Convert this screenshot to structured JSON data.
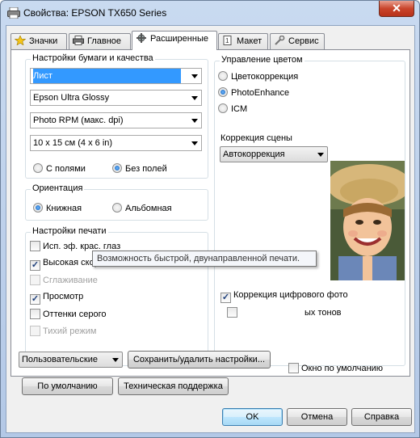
{
  "window": {
    "title": "Свойства: EPSON TX650 Series",
    "close_glyph": "✕"
  },
  "tabs": [
    {
      "label": "Значки",
      "icon": "star-icon"
    },
    {
      "label": "Главное",
      "icon": "printer-icon"
    },
    {
      "label": "Расширенные",
      "icon": "gear-icon",
      "active": true
    },
    {
      "label": "Макет",
      "icon": "page-layout-icon"
    },
    {
      "label": "Сервис",
      "icon": "wrench-icon"
    }
  ],
  "paper": {
    "group_label": "Настройки бумаги и качества",
    "source": "Лист",
    "type": "Epson Ultra Glossy",
    "quality": "Photo RPM (макс. dpi)",
    "size": "10 x 15 см (4 x 6 in)",
    "border_with": "С полями",
    "border_without": "Без полей"
  },
  "orientation": {
    "group_label": "Ориентация",
    "portrait": "Книжная",
    "landscape": "Альбомная"
  },
  "print_settings": {
    "group_label": "Настройки печати",
    "red_eye": "Исп. эф. крас. глаз",
    "high_speed": "Высокая скорость",
    "smoothing": "Сглаживание",
    "preview": "Просмотр",
    "grayscale": "Оттенки серого",
    "quiet": "Тихий режим"
  },
  "color_mgmt": {
    "group_label": "Управление цветом",
    "color_correction": "Цветокоррекция",
    "photo_enhance": "PhotoEnhance",
    "icm": "ICM",
    "scene_label": "Коррекция сцены",
    "scene_value": "Автокоррекция",
    "digital_photo": "Коррекция цифрового фото",
    "skin_tones_partial": "ых тонов"
  },
  "tooltip": "Возможность быстрой, двунаправленной печати.",
  "bottom": {
    "preset": "Пользовательские",
    "save_btn": "Сохранить/удалить настройки...",
    "default_window": "Окно по умолчанию",
    "defaults_btn": "По умолчанию",
    "support_btn": "Техническая поддержка"
  },
  "dialog": {
    "ok": "OK",
    "cancel": "Отмена",
    "help": "Справка"
  },
  "colors": {
    "accent_selection": "#3399ff",
    "check_mark": "#1c3e7a",
    "title_bar": "#c9daf0",
    "close_red": "#c9452c"
  }
}
